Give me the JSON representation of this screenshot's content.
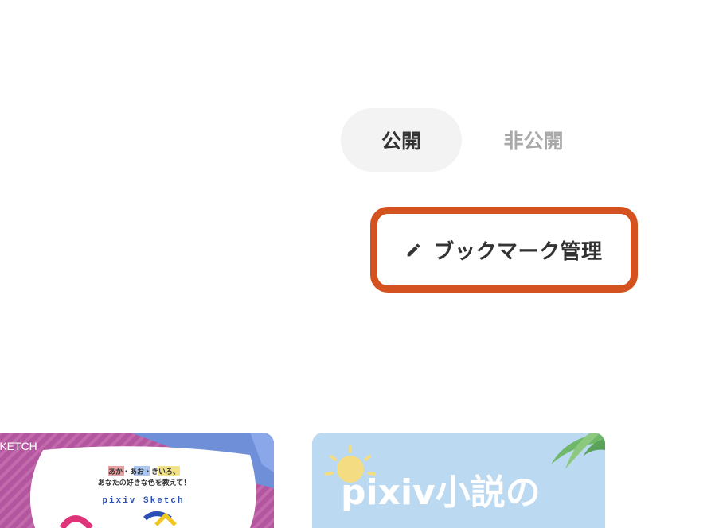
{
  "tabs": {
    "public_label": "公開",
    "private_label": "非公開"
  },
  "manage_button": {
    "label": "ブックマーク管理",
    "icon": "pencil-icon"
  },
  "cards": [
    {
      "brand": "SKETCH",
      "subtitle1": "あか・あお・きいろ、",
      "subtitle2": "あなたの好きな色を教えて！",
      "name": "pixiv Sketch"
    },
    {
      "title": "pixiv小説の"
    }
  ],
  "colors": {
    "highlight": "#d4521f",
    "active_tab_bg": "#f3f3f3",
    "text_primary": "#333333",
    "text_muted": "#a9a9a9",
    "sketch_pink": "#b4569f",
    "sketch_blue": "#6f8fd8",
    "novel_sky": "#bcd9f2"
  }
}
